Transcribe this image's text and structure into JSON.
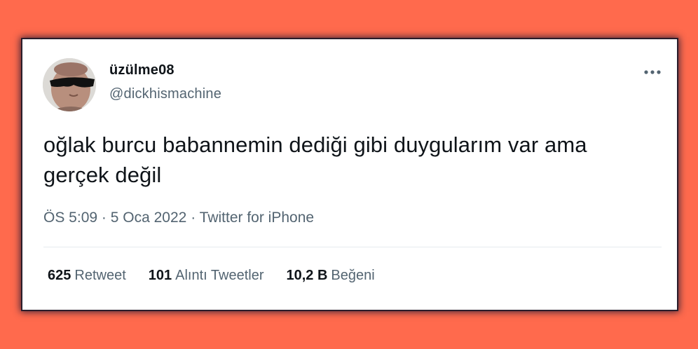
{
  "tweet": {
    "display_name": "üzülme08",
    "username": "@dickhismachine",
    "text_line1": "oğlak burcu babannemin dediği gibi duygularım var ama",
    "text_line2": "gerçek değil",
    "time": "ÖS 5:09",
    "separator": "·",
    "date": "5 Oca 2022",
    "source": "Twitter for iPhone",
    "more_icon": "more-horizontal-icon",
    "avatar": "avatar-image"
  },
  "stats": {
    "retweets_count": "625",
    "retweets_label": "Retweet",
    "quotes_count": "101",
    "quotes_label": "Alıntı Tweetler",
    "likes_count": "10,2 B",
    "likes_label": "Beğeni"
  },
  "colors": {
    "background": "#ff6a4d",
    "card": "#ffffff",
    "text_primary": "#0f1419",
    "text_secondary": "#536471"
  }
}
